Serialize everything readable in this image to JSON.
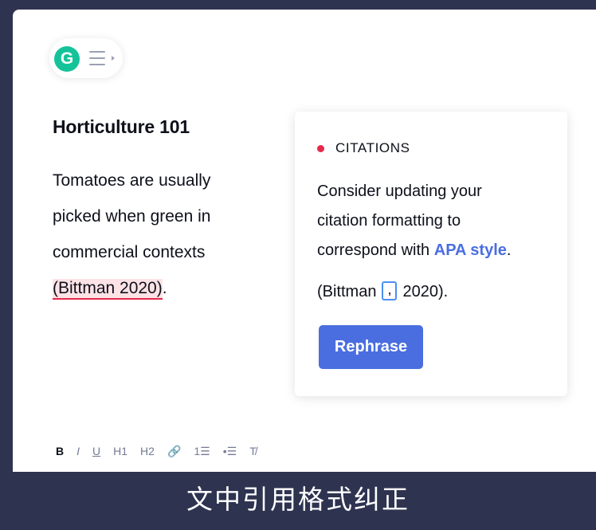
{
  "editor": {
    "logo_letter": "G",
    "title": "Horticulture 101",
    "body_lines": [
      "Tomatoes are usually",
      "picked when green in",
      "commercial contexts"
    ],
    "citation_text": "(Bittman 2020)",
    "citation_trailing": "."
  },
  "card": {
    "category": "CITATIONS",
    "message_lines": [
      "Consider updating your",
      "citation formatting to",
      "correspond with "
    ],
    "message_emphasis": "APA style",
    "message_trailing": ".",
    "example_before": "(Bittman ",
    "example_insert": ",",
    "example_after": " 2020).",
    "action_label": "Rephrase"
  },
  "toolbar": {
    "bold": "B",
    "italic": "I",
    "underline": "U",
    "h1": "H1",
    "h2": "H2",
    "link": "🔗",
    "ordered_list": "1☰",
    "bullet_list": "•☰",
    "clear_format": "T̸"
  },
  "caption": "文中引用格式纠正",
  "colors": {
    "brand_green": "#15c39a",
    "accent_blue": "#4a6ee0",
    "alert_red": "#e5294b",
    "frame_bg": "#2e3350"
  },
  "icons": [
    "grammarly-logo-icon",
    "menu-icon",
    "link-icon",
    "ordered-list-icon",
    "bullet-list-icon",
    "clear-format-icon"
  ]
}
